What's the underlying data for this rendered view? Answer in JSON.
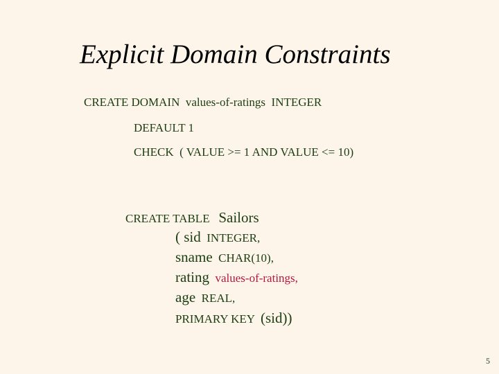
{
  "slide": {
    "title": "Explicit Domain Constraints",
    "domain_def": {
      "line1_keyword": "CREATE DOMAIN",
      "line1_name": "values-of-ratings",
      "line1_type": "INTEGER",
      "line2": "DEFAULT 1",
      "line3": "CHECK  ( VALUE >= 1 AND VALUE <= 10)"
    },
    "table_def": {
      "keyword": "CREATE TABLE",
      "table_name": "Sailors",
      "columns": [
        {
          "prefix": "( ",
          "name": "sid",
          "type": "INTEGER,"
        },
        {
          "prefix": "",
          "name": "sname",
          "type": "CHAR(10),"
        },
        {
          "prefix": "",
          "name": "rating",
          "type": "values-of-ratings,"
        },
        {
          "prefix": "",
          "name": "age",
          "type": "REAL,"
        }
      ],
      "pk_keyword": "PRIMARY KEY",
      "pk_value": "(sid))"
    },
    "page_number": "5",
    "colors": {
      "background": "#fef5ea",
      "text": "#1a3d12",
      "highlight": "#b5163f"
    }
  }
}
